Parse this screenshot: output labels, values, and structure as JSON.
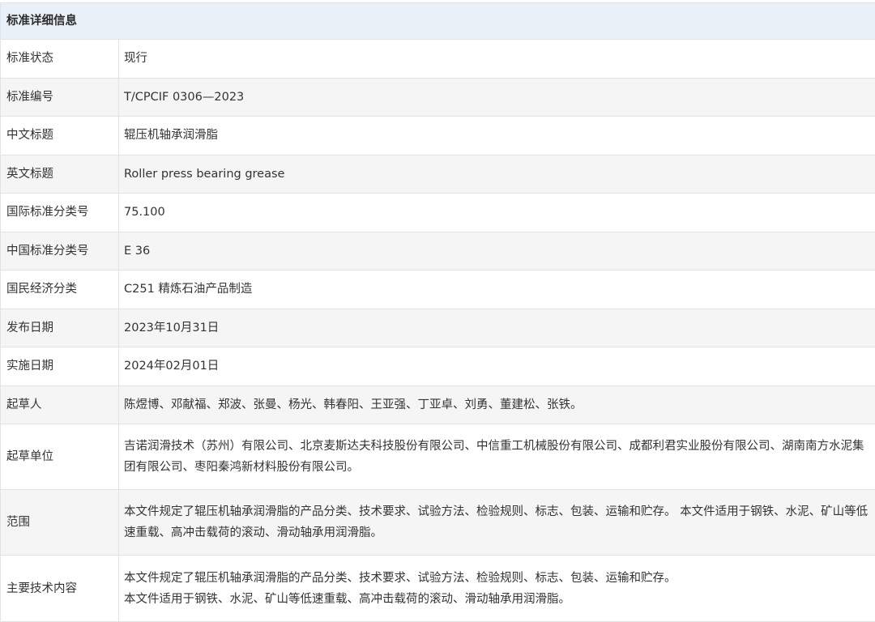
{
  "header": {
    "title": "标准详细信息"
  },
  "rows": [
    {
      "label": "标准状态",
      "value": "现行"
    },
    {
      "label": "标准编号",
      "value": "T/CPCIF 0306—2023"
    },
    {
      "label": "中文标题",
      "value": "辊压机轴承润滑脂"
    },
    {
      "label": "英文标题",
      "value": "Roller press bearing grease"
    },
    {
      "label": "国际标准分类号",
      "value": "75.100"
    },
    {
      "label": "中国标准分类号",
      "value": "E 36"
    },
    {
      "label": "国民经济分类",
      "value": "C251 精炼石油产品制造"
    },
    {
      "label": "发布日期",
      "value": "2023年10月31日"
    },
    {
      "label": "实施日期",
      "value": "2024年02月01日"
    },
    {
      "label": "起草人",
      "value": "陈煜博、邓献福、郑波、张曼、杨光、韩春阳、王亚强、丁亚卓、刘勇、董建松、张铁。"
    },
    {
      "label": "起草单位",
      "value": "吉诺润滑技术（苏州）有限公司、北京麦斯达夫科技股份有限公司、中信重工机械股份有限公司、成都利君实业股份有限公司、湖南南方水泥集团有限公司、枣阳秦鸿新材料股份有限公司。"
    },
    {
      "label": "范围",
      "value": "本文件规定了辊压机轴承润滑脂的产品分类、技术要求、试验方法、检验规则、标志、包装、运输和贮存。 本文件适用于钢铁、水泥、矿山等低速重载、高冲击载荷的滚动、滑动轴承用润滑脂。"
    },
    {
      "label": "主要技术内容",
      "value_lines": [
        "本文件规定了辊压机轴承润滑脂的产品分类、技术要求、试验方法、检验规则、标志、包装、运输和贮存。",
        "本文件适用于钢铁、水泥、矿山等低速重载、高冲击载荷的滚动、滑动轴承用润滑脂。"
      ]
    }
  ]
}
